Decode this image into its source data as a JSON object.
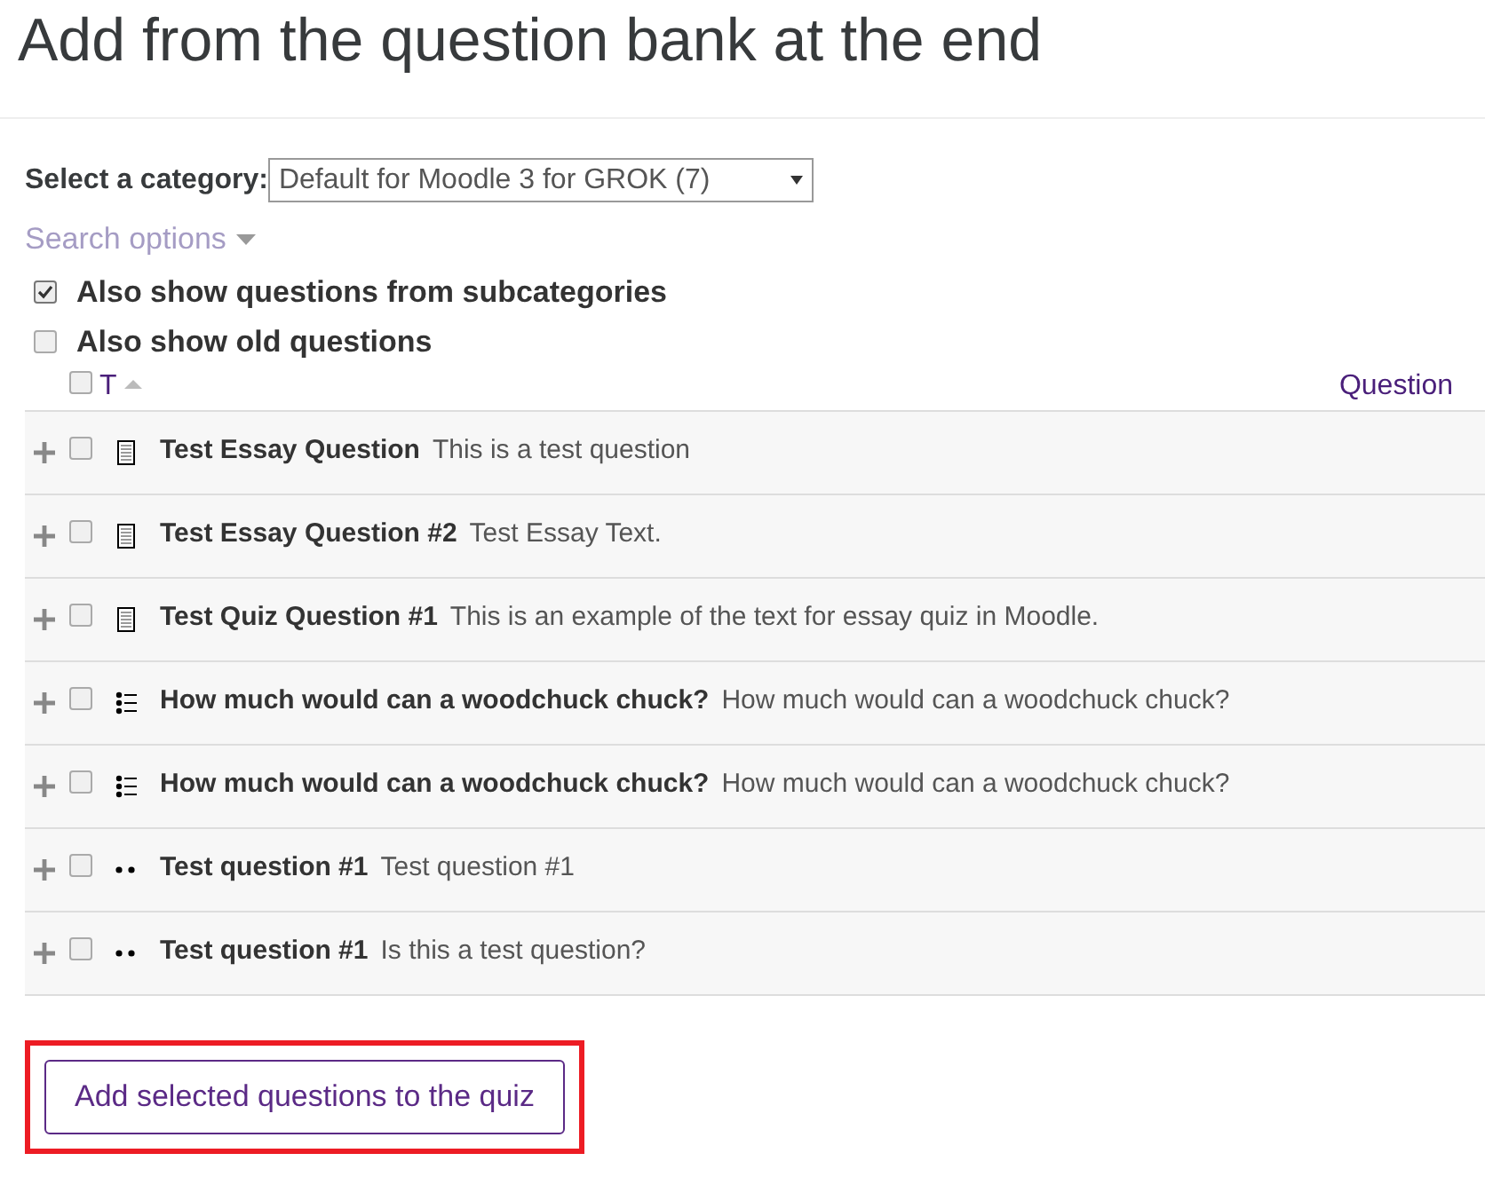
{
  "heading": "Add from the question bank at the end",
  "category": {
    "label": "Select a category:",
    "value": "Default for Moodle 3 for GROK (7)"
  },
  "search_options": "Search options",
  "options": [
    {
      "label": "Also show questions from subcategories",
      "checked": true
    },
    {
      "label": "Also show old questions",
      "checked": false
    }
  ],
  "table": {
    "select_all_checked": false,
    "type_column": "T",
    "question_column": "Question",
    "rows": [
      {
        "kind": "essay",
        "name": "Test Essay Question",
        "text": "This is a test question",
        "checked": false
      },
      {
        "kind": "essay",
        "name": "Test Essay Question #2",
        "text": "Test Essay Text.",
        "checked": false
      },
      {
        "kind": "essay",
        "name": "Test Quiz Question #1",
        "text": "This is an example of the text for essay quiz in Moodle.",
        "checked": false
      },
      {
        "kind": "multichoice",
        "name": "How much would can a woodchuck chuck?",
        "text": "How much would can a woodchuck chuck?",
        "checked": false
      },
      {
        "kind": "multichoice",
        "name": "How much would can a woodchuck chuck?",
        "text": "How much would can a woodchuck chuck?",
        "checked": false
      },
      {
        "kind": "shortanswer",
        "name": "Test question #1",
        "text": "Test question #1",
        "checked": false
      },
      {
        "kind": "shortanswer",
        "name": "Test question #1",
        "text": "Is this a test question?",
        "checked": false
      }
    ]
  },
  "submit": {
    "label": "Add selected questions to the quiz",
    "highlighted": true
  }
}
